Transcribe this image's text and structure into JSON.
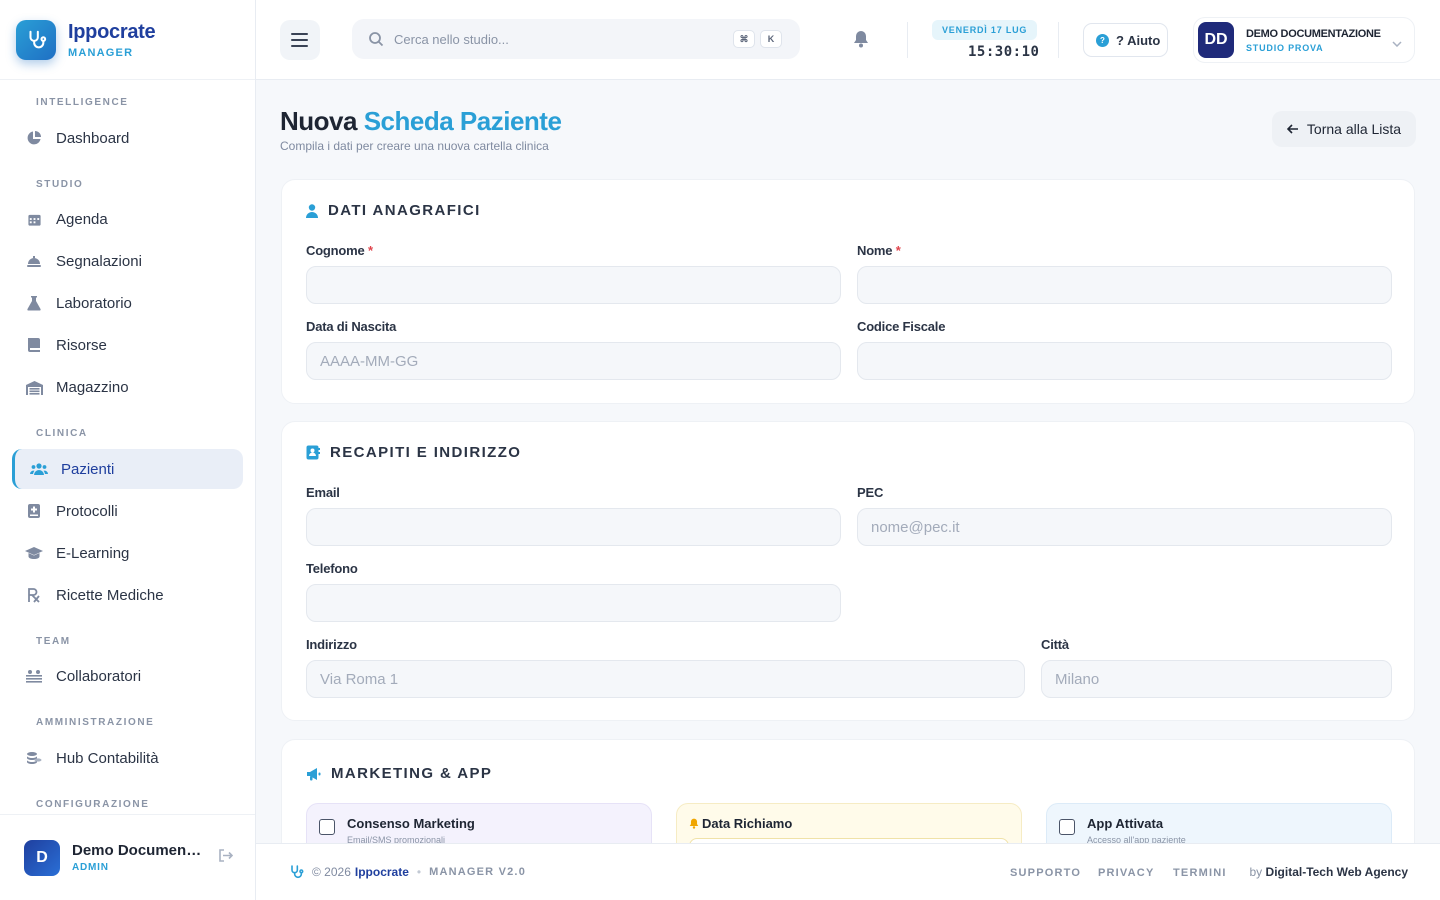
{
  "brand": {
    "name": "Ippocrate",
    "sub": "MANAGER"
  },
  "sidebar": {
    "sections": {
      "intelligence": "INTELLIGENCE",
      "studio": "STUDIO",
      "clinica": "CLINICA",
      "team": "TEAM",
      "amministrazione": "AMMINISTRAZIONE",
      "configurazione": "CONFIGURAZIONE"
    },
    "items": {
      "dashboard": "Dashboard",
      "agenda": "Agenda",
      "segnalazioni": "Segnalazioni",
      "laboratorio": "Laboratorio",
      "risorse": "Risorse",
      "magazzino": "Magazzino",
      "pazienti": "Pazienti",
      "protocolli": "Protocolli",
      "elearning": "E-Learning",
      "ricette": "Ricette Mediche",
      "collaboratori": "Collaboratori",
      "hub": "Hub Contabilità"
    },
    "user": {
      "initial": "D",
      "name": "Demo Documentazione",
      "role": "ADMIN"
    }
  },
  "header": {
    "search_placeholder": "Cerca nello studio...",
    "kbd": [
      "⌘",
      "K"
    ],
    "date": "VENERDÌ 17 LUG",
    "time": "15:30:10",
    "help": "? Aiuto",
    "help_icon": "?",
    "profile": {
      "initials": "DD",
      "name": "DEMO DOCUMENTAZIONE",
      "studio": "STUDIO PROVA"
    }
  },
  "page": {
    "title_a": "Nuova",
    "title_b": "Scheda Paziente",
    "subtitle": "Compila i dati per creare una nuova cartella clinica",
    "back": "Torna alla Lista"
  },
  "anagrafici": {
    "title": "DATI ANAGRAFICI",
    "cognome": "Cognome",
    "nome": "Nome",
    "required_mark": "*",
    "data_nascita": "Data di Nascita",
    "data_nascita_ph": "AAAA-MM-GG",
    "codice_fiscale": "Codice Fiscale"
  },
  "recapiti": {
    "title": "RECAPITI E INDIRIZZO",
    "email": "Email",
    "pec": "PEC",
    "pec_ph": "nome@pec.it",
    "telefono": "Telefono",
    "indirizzo": "Indirizzo",
    "indirizzo_ph": "Via Roma 1",
    "citta": "Città",
    "citta_ph": "Milano"
  },
  "marketing": {
    "title": "MARKETING & APP",
    "consenso": "Consenso Marketing",
    "consenso_sub": "Email/SMS promozionali",
    "richiamo": "Data Richiamo",
    "app": "App Attivata",
    "app_sub": "Accesso all'app paziente"
  },
  "footer": {
    "copy": "© 2026",
    "brand": "Ippocrate",
    "version": "MANAGER V2.0",
    "supporto": "SUPPORTO",
    "privacy": "PRIVACY",
    "termini": "TERMINI",
    "by": "by",
    "agency": "Digital-Tech Web Agency"
  },
  "colors": {
    "accent": "#2a9fd6",
    "brand": "#1f3f9e",
    "required": "#e0454d"
  }
}
